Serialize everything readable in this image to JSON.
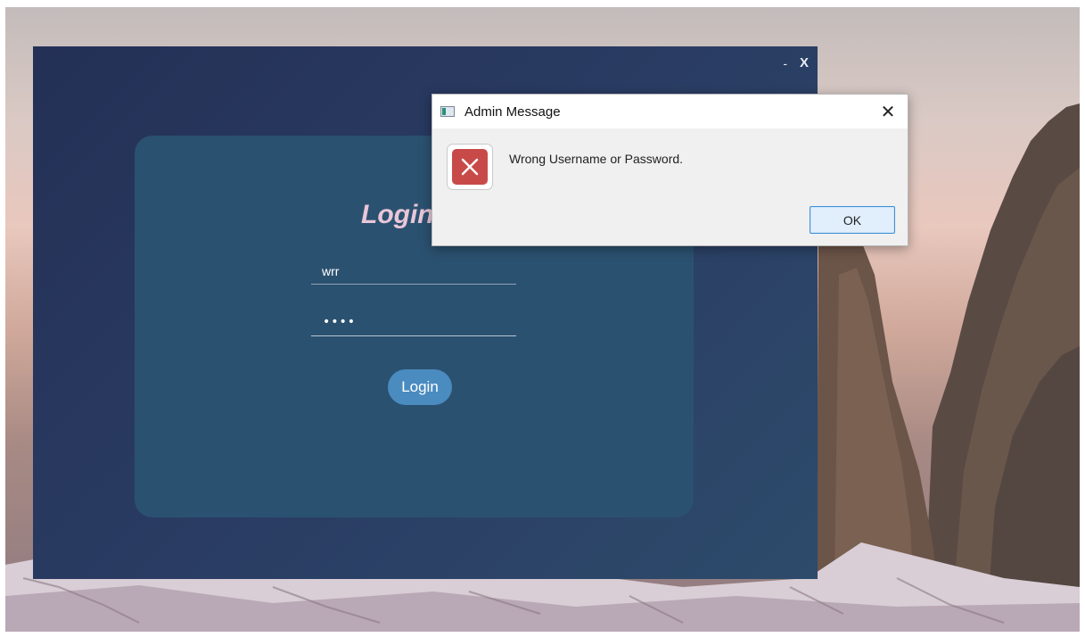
{
  "app_window": {
    "minimize_label": "-",
    "close_label": "X",
    "login_title": "Login",
    "username_value": "wrr",
    "password_mask": "••••",
    "login_button_label": "Login"
  },
  "dialog": {
    "title": "Admin Message",
    "close_glyph": "✕",
    "message": "Wrong Username or Password.",
    "ok_label": "OK",
    "icon": "error-icon"
  },
  "colors": {
    "window_bg": "#2a3c63",
    "card_bg": "#2b5170",
    "title_color": "#e9c6d8",
    "button_bg": "#4a8bc0",
    "error_red": "#c84a48"
  }
}
